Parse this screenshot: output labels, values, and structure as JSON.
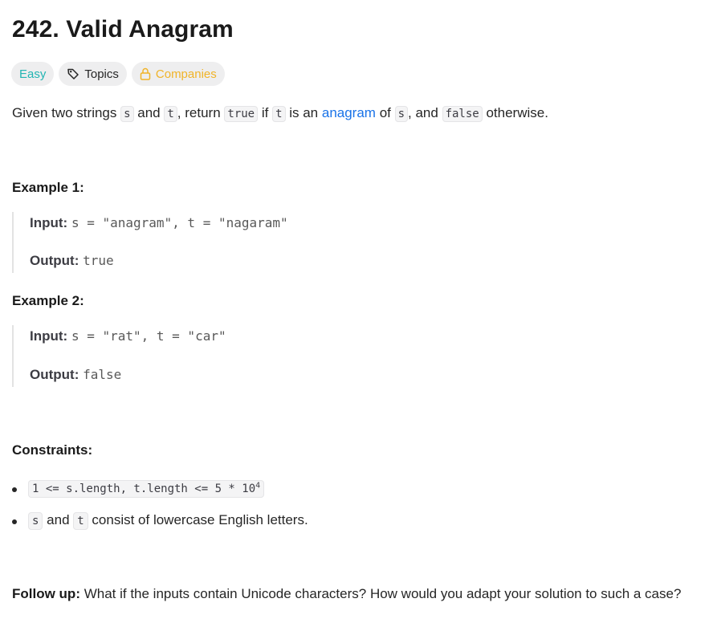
{
  "problem": {
    "title": "242. Valid Anagram",
    "tags": {
      "difficulty": "Easy",
      "topics": "Topics",
      "companies": "Companies"
    },
    "description": {
      "p1": "Given two strings ",
      "s1": "s",
      "p2": " and ",
      "t1": "t",
      "p3": ", return ",
      "true_code": "true",
      "p4": " if ",
      "t2": "t",
      "p5": " is an ",
      "link": "anagram",
      "p6": " of ",
      "s2": "s",
      "p7": ", and ",
      "false_code": "false",
      "p8": " otherwise."
    },
    "examples": [
      {
        "heading": "Example 1:",
        "input_label": "Input:",
        "input_value": "s = \"anagram\", t = \"nagaram\"",
        "output_label": "Output:",
        "output_value": "true"
      },
      {
        "heading": "Example 2:",
        "input_label": "Input:",
        "input_value": "s = \"rat\", t = \"car\"",
        "output_label": "Output:",
        "output_value": "false"
      }
    ],
    "constraints": {
      "heading": "Constraints:",
      "c1_code": "1 <= s.length, t.length <= 5 * 10",
      "c1_sup": "4",
      "c2_s": "s",
      "c2_and": " and ",
      "c2_t": "t",
      "c2_rest": " consist of lowercase English letters."
    },
    "follow_up": {
      "label": "Follow up:",
      "text": " What if the inputs contain Unicode characters? How would you adapt your solution to such a case?"
    }
  },
  "colors": {
    "easy": "#23b5b3",
    "companies": "#f0b429",
    "link": "#1a73e8"
  }
}
